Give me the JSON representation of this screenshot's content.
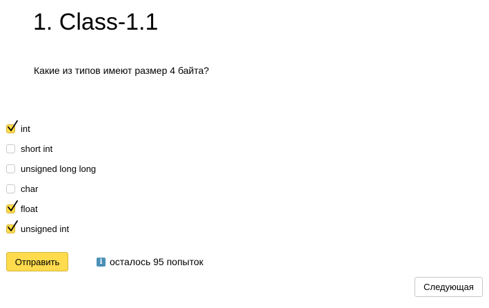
{
  "title": "1. Class-1.1",
  "question": "Какие из типов имеют размер 4 байта?",
  "options": [
    {
      "label": "int",
      "checked": true
    },
    {
      "label": "short int",
      "checked": false
    },
    {
      "label": "unsigned long long",
      "checked": false
    },
    {
      "label": "char",
      "checked": false
    },
    {
      "label": "float",
      "checked": true
    },
    {
      "label": "unsigned int",
      "checked": true
    }
  ],
  "submit_label": "Отправить",
  "attempts": {
    "icon": "info-icon",
    "text": "осталось 95 попыток"
  },
  "next_label": "Следующая",
  "colors": {
    "accent": "#ffdb4d",
    "info": "#4a90b8"
  }
}
